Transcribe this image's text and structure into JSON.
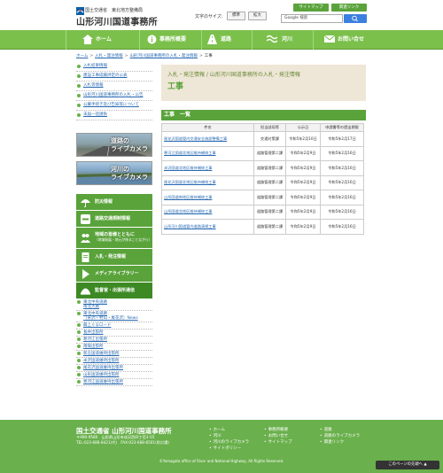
{
  "header": {
    "org": "国土交通省　東北地方整備局",
    "office_name": "山形河川国道事務所",
    "sitemap_label": "サイトマップ",
    "related_links_label": "関連リンク",
    "text_size_label": "文字のサイズ:",
    "size_standard": "標準",
    "size_large": "拡大",
    "search_brand": "Google",
    "search_placeholder": "検索"
  },
  "nav": {
    "items": [
      "ホーム",
      "事務所概要",
      "道路",
      "河川",
      "お問い合せ"
    ]
  },
  "breadcrumb": [
    "ホーム",
    "入札・発注情報",
    "山形河川国道事務所の入札・発注情報",
    "工事"
  ],
  "sidebar": {
    "links": [
      "入札結果情報",
      "建設工事成績評定の公表",
      "入札等情報",
      "山形河川国道事務所の入札・公告",
      "公募手続き及び告知等について",
      "未届一括請負"
    ],
    "road_camera": "道路の\nライブカメラ",
    "river_camera": "河川の\nライブカメラ",
    "menu": [
      {
        "label": "防災情報",
        "sub": ""
      },
      {
        "label": "道路交通規制情報",
        "sub": ""
      },
      {
        "label": "地域の皆様とともに",
        "sub": "（地域発展・地元が係ることながら）"
      },
      {
        "label": "入札・発注情報",
        "sub": ""
      },
      {
        "label": "メディアライブラリー",
        "sub": ""
      },
      {
        "label": "監督官・出張所通信",
        "sub": ""
      }
    ],
    "subitems": [
      "東北中央道路\n南北大路",
      "東北中央道路\n（米沢・村山・尾花沢）News",
      "最上ぐるロード",
      "長井出張所",
      "寒河江出張所",
      "南陽出張所",
      "新庄国道維持出張所",
      "米沢国道維持出張所",
      "尾花沢国道維持出張所",
      "山形国道維持出張所",
      "寒河江国道維持出張所"
    ]
  },
  "main": {
    "title_sub": "入札・発注情報 / 山形河川国道事務所の入札・発注情報",
    "title": "工事",
    "section_heading": "工事　一覧",
    "table": {
      "headers": [
        "件名",
        "担当部局等",
        "公示日",
        "申請書等の提出期限"
      ],
      "rows": [
        [
          "尾花沢国道管内交通安全施設整備工事",
          "交通対策課",
          "令和5年2月10日",
          "令和5年2月17日"
        ],
        [
          "寒河江国道北地区維持補修工事",
          "道路管理第二課",
          "令和5年2月9日",
          "令和5年2月16日"
        ],
        [
          "米沢国道北地区維持補修工事",
          "道路管理第二課",
          "令和5年2月9日",
          "令和5年2月16日"
        ],
        [
          "尾花沢国道北地区維持補修工事",
          "道路管理第二課",
          "令和5年2月9日",
          "令和5年2月16日"
        ],
        [
          "山形国道南地区維持補修工事",
          "道路管理第二課",
          "令和5年2月9日",
          "令和5年2月16日"
        ],
        [
          "山形国道北地区維持補修工事",
          "道路管理第二課",
          "令和5年2月9日",
          "令和5年2月16日"
        ],
        [
          "山形河川国道管内道路清掃工事",
          "道路管理第二課",
          "令和5年2月9日",
          "令和5年2月16日"
        ]
      ]
    }
  },
  "footer": {
    "name": "国土交通省 山形河川国道事務所",
    "address": "〒990-9580　山形県山形市成沢西四丁目3-55",
    "tel": "TEL:023-688-8421(代)　FAX:023-688-8501(防災課)",
    "links_col1": [
      "ホーム",
      "河川",
      "河川のライブカメラ",
      "サイトポリシー"
    ],
    "links_col2": [
      "事務所概要",
      "お問い合せ",
      "サイトマップ"
    ],
    "links_col3": [
      "道路",
      "道路のライブカメラ",
      "関連リンク"
    ],
    "copyright": "©Yamagata office of River and National Highway, All Rights Reserved.",
    "pagetop": "このページの先頭へ"
  },
  "colors": {
    "brand_green": "#5aa33b",
    "nav_green": "#7cc04c",
    "title_beige": "#eee6d6",
    "link_blue": "#2a6bb3"
  }
}
